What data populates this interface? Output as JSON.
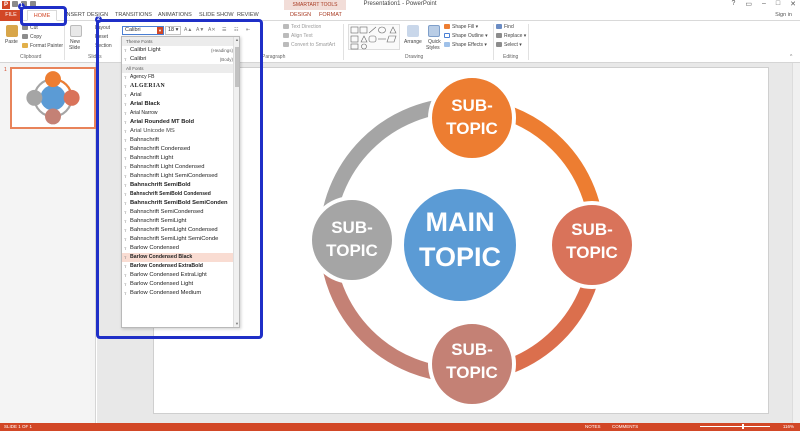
{
  "window": {
    "title": "Presentation1 - PowerPoint",
    "contextual_group": "SMARTART TOOLS",
    "sign_in": "Sign in",
    "app_logo": "P"
  },
  "tabs": [
    "FILE",
    "HOME",
    "INSERT",
    "DESIGN",
    "TRANSITIONS",
    "ANIMATIONS",
    "SLIDE SHOW",
    "REVIEW",
    "DESIGN",
    "FORMAT"
  ],
  "ribbon": {
    "clipboard": {
      "label": "Clipboard",
      "paste": "Paste",
      "cut": "Cut",
      "copy": "Copy",
      "format_painter": "Format Painter"
    },
    "slides": {
      "label": "Slides",
      "new_slide": "New",
      "new_slide2": "Slide",
      "layout": "Layout",
      "reset": "Reset",
      "section": "Section"
    },
    "font": {
      "name": "Calibri",
      "size": "18"
    },
    "paragraph": {
      "label": "Paragraph",
      "text_direction": "Text Direction",
      "align_text": "Align Text",
      "convert": "Convert to SmartArt"
    },
    "drawing": {
      "label": "Drawing",
      "arrange": "Arrange",
      "quick_styles": "Quick",
      "quick_styles2": "Styles",
      "shape_fill": "Shape Fill",
      "shape_outline": "Shape Outline",
      "shape_effects": "Shape Effects"
    },
    "editing": {
      "label": "Editing",
      "find": "Find",
      "replace": "Replace",
      "select": "Select"
    }
  },
  "annotations": {
    "badge1": "1",
    "badge2": "2"
  },
  "font_dropdown": {
    "theme_header": "Theme Fonts",
    "theme_fonts": [
      {
        "name": "Calibri Light",
        "hint": "(Headings)"
      },
      {
        "name": "Calibri",
        "hint": "(Body)"
      }
    ],
    "all_header": "All Fonts",
    "all_fonts": [
      "Agency FB",
      "ALGERIAN",
      "Arial",
      "Arial Black",
      "Arial Narrow",
      "Arial Rounded MT Bold",
      "Arial Unicode MS",
      "Bahnschrift",
      "Bahnschrift Condensed",
      "Bahnschrift Light",
      "Bahnschrift Light Condensed",
      "Bahnschrift Light SemiCondensed",
      "Bahnschrift SemiBold",
      "Bahnschrift SemiBold Condensed",
      "Bahnschrift SemiBold SemiConden",
      "Bahnschrift SemiCondensed",
      "Bahnschrift SemiLight",
      "Bahnschrift SemiLight Condensed",
      "Bahnschrift SemiLight SemiConde",
      "Barlow Condensed",
      "Barlow Condensed Black",
      "Barlow Condensed ExtraBold",
      "Barlow Condensed ExtraLight",
      "Barlow Condensed Light",
      "Barlow Condensed Medium"
    ],
    "selected": "Barlow Condensed Black"
  },
  "slide_panel": {
    "number": "1"
  },
  "diagram": {
    "main": "MAIN\nTOPIC",
    "main_color": "#5b9bd5",
    "subs": [
      {
        "text": "SUB-\nTOPIC",
        "color": "#ed7d31",
        "arc_color": "#ed7d31"
      },
      {
        "text": "SUB-\nTOPIC",
        "color": "#d9735a",
        "arc_color": "#db6f4d"
      },
      {
        "text": "SUB-\nTOPIC",
        "color": "#c48175",
        "arc_color": "#c48175"
      },
      {
        "text": "SUB-\nTOPIC",
        "color": "#a5a5a5",
        "arc_color": "#a5a5a5"
      }
    ]
  },
  "statusbar": {
    "slide": "SLIDE 1 OF 1",
    "notes": "NOTES",
    "comments": "COMMENTS",
    "zoom": "116%"
  },
  "colors": {
    "accent": "#d24726",
    "highlight": "#1f2fc7"
  }
}
